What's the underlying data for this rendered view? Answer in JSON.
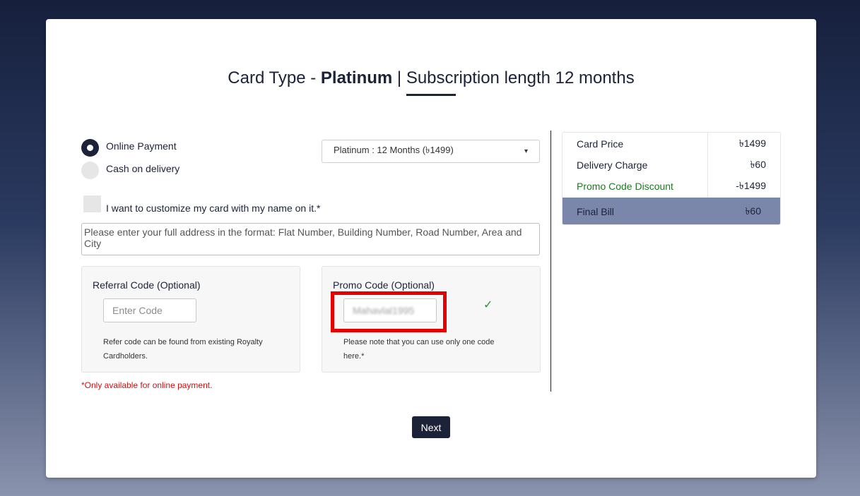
{
  "title": {
    "prefix": "Card Type - ",
    "card_type": "Platinum",
    "separator": " | ",
    "subscription": "Subscription length 12 months"
  },
  "payment": {
    "options": [
      {
        "label": "Online Payment",
        "selected": true
      },
      {
        "label": "Cash on delivery",
        "selected": false
      }
    ]
  },
  "plan_select": {
    "value": "Platinum : 12 Months (৳1499)",
    "caret": "▾"
  },
  "customize": {
    "label": "I want to customize my card with my name on it.*",
    "checked": false
  },
  "address": {
    "placeholder": "Please enter your full address in the format: Flat Number, Building Number, Road Number, Area and City"
  },
  "referral": {
    "title": "Referral Code (Optional)",
    "placeholder": "Enter Code",
    "note": "Refer code can be found from existing Royalty Cardholders."
  },
  "promo": {
    "title": "Promo Code (Optional)",
    "value": "Mahavlal1995",
    "check": "✓",
    "note": "Please note that you can use only one code here.*"
  },
  "online_note": "*Only available for online payment.",
  "summary": {
    "card_price_label": "Card Price",
    "card_price_value": "৳1499",
    "delivery_label": "Delivery Charge",
    "delivery_value": "৳60",
    "discount_label": "Promo Code Discount",
    "discount_value": "-৳1499",
    "final_label": "Final Bill",
    "final_value": "৳60"
  },
  "next_label": "Next",
  "colors": {
    "primary": "#1c2238",
    "final_bill_bg": "#7a87ab",
    "discount": "#1f7a1f",
    "highlight": "#e60000",
    "error": "#d01010"
  }
}
